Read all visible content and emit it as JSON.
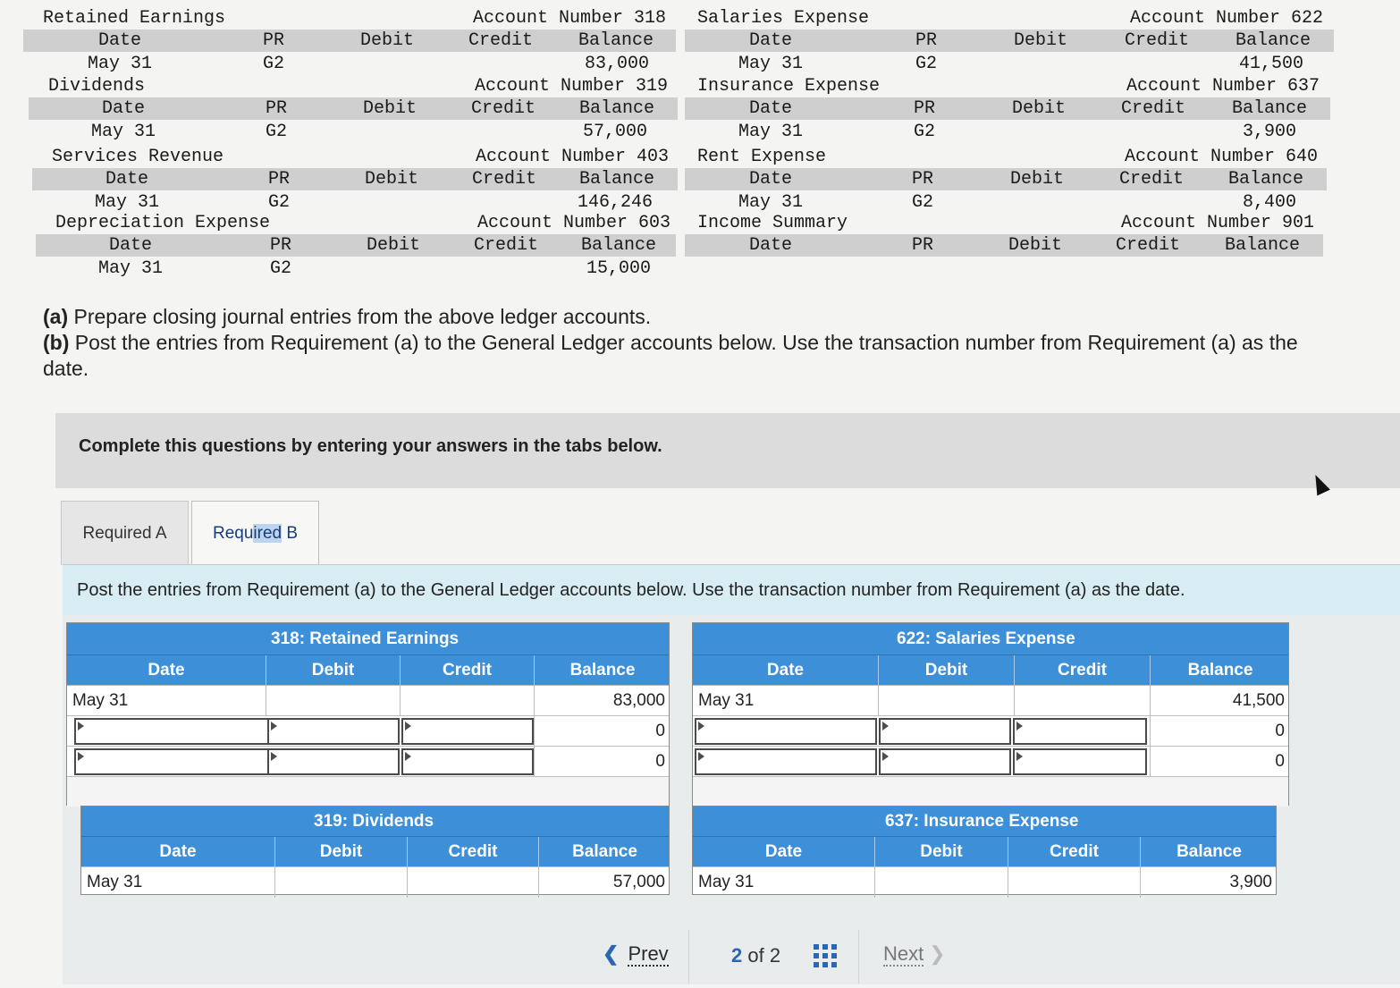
{
  "ledger": {
    "headers": {
      "date": "Date",
      "pr": "PR",
      "debit": "Debit",
      "credit": "Credit",
      "balance": "Balance"
    },
    "left": [
      {
        "name": "Retained Earnings",
        "account": "Account Number 318",
        "date": "May 31",
        "pr": "G2",
        "balance": "83,000"
      },
      {
        "name": "Dividends",
        "account": "Account Number 319",
        "date": "May 31",
        "pr": "G2",
        "balance": "57,000"
      },
      {
        "name": "Services Revenue",
        "account": "Account Number 403",
        "date": "May 31",
        "pr": "G2",
        "balance": "146,246"
      },
      {
        "name": "Depreciation Expense",
        "account": "Account Number 603",
        "date": "May 31",
        "pr": "G2",
        "balance": "15,000"
      }
    ],
    "right": [
      {
        "name": "Salaries Expense",
        "account": "Account Number 622",
        "date": "May 31",
        "pr": "G2",
        "balance": "41,500"
      },
      {
        "name": "Insurance Expense",
        "account": "Account Number 637",
        "date": "May 31",
        "pr": "G2",
        "balance": "3,900"
      },
      {
        "name": "Rent Expense",
        "account": "Account Number 640",
        "date": "May 31",
        "pr": "G2",
        "balance": "8,400"
      },
      {
        "name": "Income Summary",
        "account": "Account Number 901",
        "date": "",
        "pr": "",
        "balance": ""
      }
    ]
  },
  "instructions": {
    "a_label": "(a)",
    "a_text": " Prepare closing journal entries from the above ledger accounts.",
    "b_label": "(b)",
    "b_text": " Post the entries from Requirement (a) to the General Ledger accounts below. Use the transaction number from Requirement (a) as the date."
  },
  "banner": "Complete this questions by entering your answers in the tabs below.",
  "tabs": [
    {
      "label": "Required A",
      "active": false
    },
    {
      "label_pre": "Requ",
      "label_hl": "ired",
      "label_post": " B",
      "active": true
    }
  ],
  "panel_instruction": "Post the entries from Requirement (a) to the General Ledger accounts below. Use the transaction number from Requirement (a) as the date.",
  "grid_headers": {
    "date": "Date",
    "debit": "Debit",
    "credit": "Credit",
    "balance": "Balance"
  },
  "grids": {
    "retained": {
      "title": "318: Retained Earnings",
      "row_date": "May 31",
      "row_balance": "83,000",
      "balance2": "0",
      "balance3": "0"
    },
    "salaries": {
      "title": "622: Salaries Expense",
      "row_date": "May 31",
      "row_balance": "41,500",
      "balance2": "0",
      "balance3": "0"
    },
    "dividends": {
      "title": "319: Dividends",
      "row_date": "May 31",
      "row_balance": "57,000"
    },
    "insurance": {
      "title": "637: Insurance Expense",
      "row_date": "May 31",
      "row_balance": "3,900"
    }
  },
  "pager": {
    "prev": "Prev",
    "current": "2",
    "of": "of",
    "total": "2",
    "next": "Next"
  },
  "colors": {
    "grid_header": "#3d8fd8",
    "panel_instr_bg": "#d8ecf3",
    "link": "#2b66b2"
  }
}
